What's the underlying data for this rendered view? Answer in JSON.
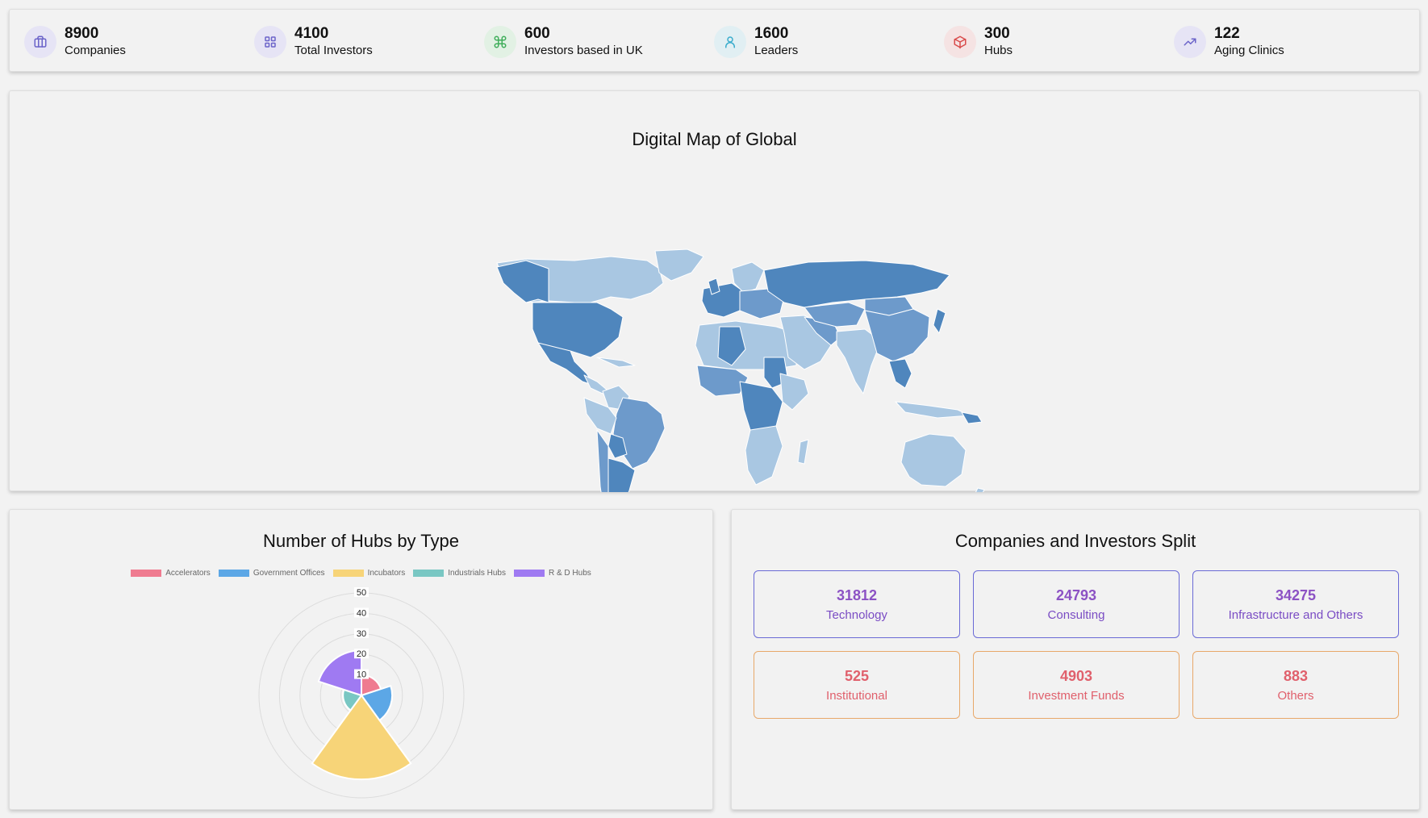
{
  "stats": [
    {
      "value": "8900",
      "label": "Companies",
      "icon": "briefcase-icon",
      "bg": "#e6e4f5",
      "stroke": "#6b63c9"
    },
    {
      "value": "4100",
      "label": "Total Investors",
      "icon": "grid-icon",
      "bg": "#e6e4f5",
      "stroke": "#6b63c9"
    },
    {
      "value": "600",
      "label": "Investors based in UK",
      "icon": "command-icon",
      "bg": "#e2f1e4",
      "stroke": "#3fae5a"
    },
    {
      "value": "1600",
      "label": "Leaders",
      "icon": "user-icon",
      "bg": "#e1eff3",
      "stroke": "#3aaccc"
    },
    {
      "value": "300",
      "label": "Hubs",
      "icon": "box-icon",
      "bg": "#f5e3e3",
      "stroke": "#d94b4b"
    },
    {
      "value": "122",
      "label": "Aging Clinics",
      "icon": "trending-up-icon",
      "bg": "#e6e4f5",
      "stroke": "#6b63c9"
    }
  ],
  "map": {
    "title": "Digital Map of Global",
    "colors": {
      "dark": "#4f86bd",
      "mid": "#6d9acb",
      "light": "#a9c7e2",
      "border": "#ffffff"
    }
  },
  "hubs": {
    "title": "Number of Hubs by Type",
    "chart_data": {
      "type": "polarArea",
      "categories": [
        "Accelerators",
        "Government Offices",
        "Incubators",
        "Industrials Hubs",
        "R & D Hubs"
      ],
      "values": [
        10,
        15,
        41,
        9,
        22
      ],
      "colors": [
        "#ef7b90",
        "#5ca7e6",
        "#f7d478",
        "#79c7c3",
        "#9f7af2"
      ],
      "r_ticks": [
        "10",
        "20",
        "30",
        "40",
        "50"
      ],
      "rlim": [
        0,
        50
      ],
      "legend": "top"
    }
  },
  "split": {
    "title": "Companies and Investors Split",
    "items": [
      {
        "value": "31812",
        "label": "Technology",
        "group": "companies"
      },
      {
        "value": "24793",
        "label": "Consulting",
        "group": "companies"
      },
      {
        "value": "34275",
        "label": "Infrastructure and Others",
        "group": "companies"
      },
      {
        "value": "525",
        "label": "Institutional",
        "group": "investors"
      },
      {
        "value": "4903",
        "label": "Investment Funds",
        "group": "investors"
      },
      {
        "value": "883",
        "label": "Others",
        "group": "investors"
      }
    ],
    "colors": {
      "companies": {
        "border": "#6a6ad6",
        "value": "#8c52c4",
        "label": "#7a4cc4"
      },
      "investors": {
        "border": "#e8a86a",
        "value": "#e0606c",
        "label": "#e0606c"
      }
    }
  }
}
